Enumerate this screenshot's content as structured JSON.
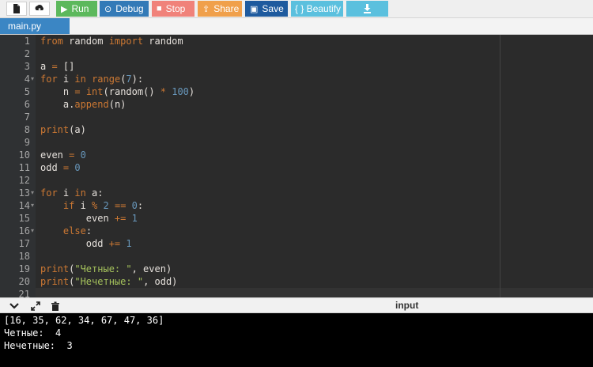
{
  "toolbar": {
    "run_label": "Run",
    "debug_label": "Debug",
    "stop_label": "Stop",
    "share_label": "Share",
    "save_label": "Save",
    "beautify_label": "{ } Beautify",
    "colors": {
      "run": "#5cb85c",
      "debug": "#337ab7",
      "stop": "#f0827a",
      "share": "#f0a04b",
      "save": "#1e5a9e",
      "beautify": "#5bc0de",
      "download": "#5bc0de"
    },
    "icons": [
      "file-icon",
      "upload-icon",
      "play-icon",
      "bug-icon",
      "stop-icon",
      "share-icon",
      "save-icon",
      "download-icon"
    ]
  },
  "tabs": [
    {
      "label": "main.py"
    }
  ],
  "editor": {
    "line_numbers": [
      "1",
      "2",
      "3",
      "4",
      "5",
      "6",
      "7",
      "8",
      "9",
      "10",
      "11",
      "12",
      "13",
      "14",
      "15",
      "16",
      "17",
      "18",
      "19",
      "20",
      "21"
    ],
    "fold_markers_on_lines": [
      4,
      13,
      14,
      16
    ],
    "lines": [
      "from random import random",
      "",
      "a = []",
      "for i in range(7):",
      "    n = int(random() * 100)",
      "    a.append(n)",
      "",
      "print(a)",
      "",
      "even = 0",
      "odd = 0",
      "",
      "for i in a:",
      "    if i % 2 == 0:",
      "        even += 1",
      "    else:",
      "        odd += 1",
      "",
      "print(\"Четные: \", even)",
      "print(\"Нечетные: \", odd)",
      ""
    ]
  },
  "output_panel": {
    "input_label": "input",
    "icons": [
      "chevron-down-icon",
      "expand-icon",
      "clear-console-icon"
    ],
    "console_lines": [
      "[16, 35, 62, 34, 67, 47, 36]",
      "Четные:  4",
      "Нечетные:  3"
    ]
  }
}
